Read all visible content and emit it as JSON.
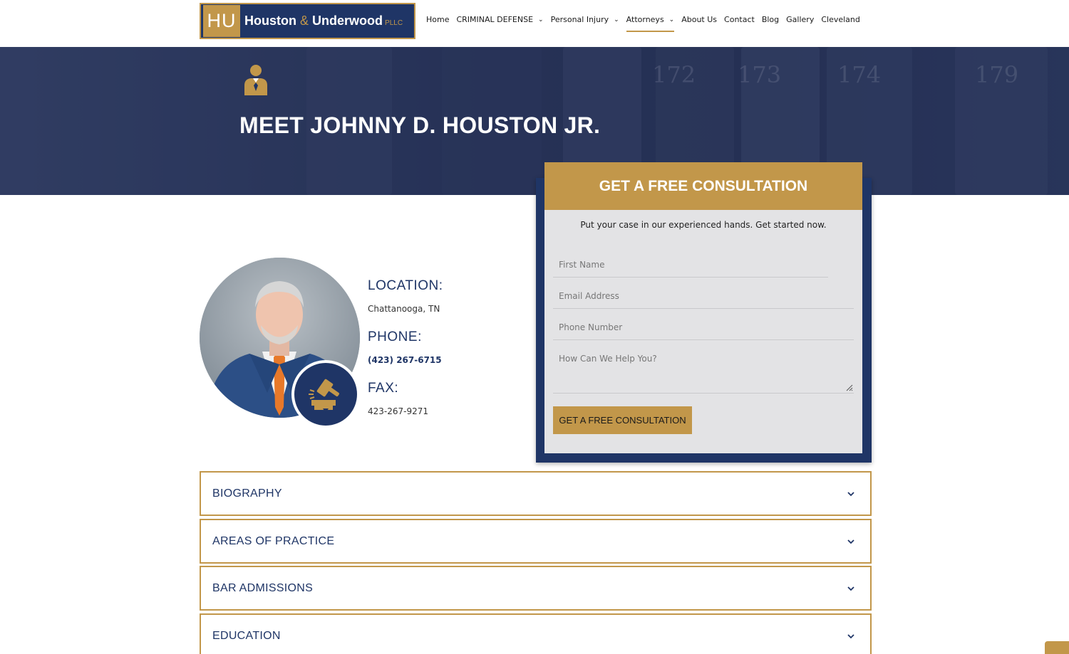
{
  "logo": {
    "mark": "HU",
    "name_part1": "Houston",
    "amp": "&",
    "name_part2": "Underwood",
    "suffix": "PLLC"
  },
  "nav": {
    "home": "Home",
    "criminal_defense": "CRIMINAL DEFENSE",
    "personal_injury": "Personal Injury",
    "attorneys": "Attorneys",
    "about": "About Us",
    "contact": "Contact",
    "blog": "Blog",
    "gallery": "Gallery",
    "cleveland": "Cleveland",
    "active": "Attorneys"
  },
  "hero": {
    "title": "MEET JOHNNY D. HOUSTON JR.",
    "icon": "attorney-icon",
    "background_numbers": [
      "172",
      "173",
      "174",
      "179"
    ]
  },
  "profile": {
    "location_label": "LOCATION:",
    "location_value": "Chattanooga, TN",
    "phone_label": "PHONE:",
    "phone_value": "(423) 267-6715",
    "fax_label": "FAX:",
    "fax_value": "423-267-9271",
    "badge_icon": "gavel-icon"
  },
  "form": {
    "title": "GET A FREE CONSULTATION",
    "subtitle": "Put your case in our experienced hands. Get started now.",
    "first_name_placeholder": "First Name",
    "email_placeholder": "Email Address",
    "phone_placeholder": "Phone Number",
    "message_placeholder": "How Can We Help You?",
    "submit_label": "GET A FREE CONSULTATION"
  },
  "accordions": [
    {
      "label": "BIOGRAPHY"
    },
    {
      "label": "AREAS OF PRACTICE"
    },
    {
      "label": "BAR ADMISSIONS"
    },
    {
      "label": "EDUCATION"
    }
  ],
  "colors": {
    "navy": "#1f3566",
    "gold": "#c2974a",
    "form_bg": "#e3e3e5"
  }
}
